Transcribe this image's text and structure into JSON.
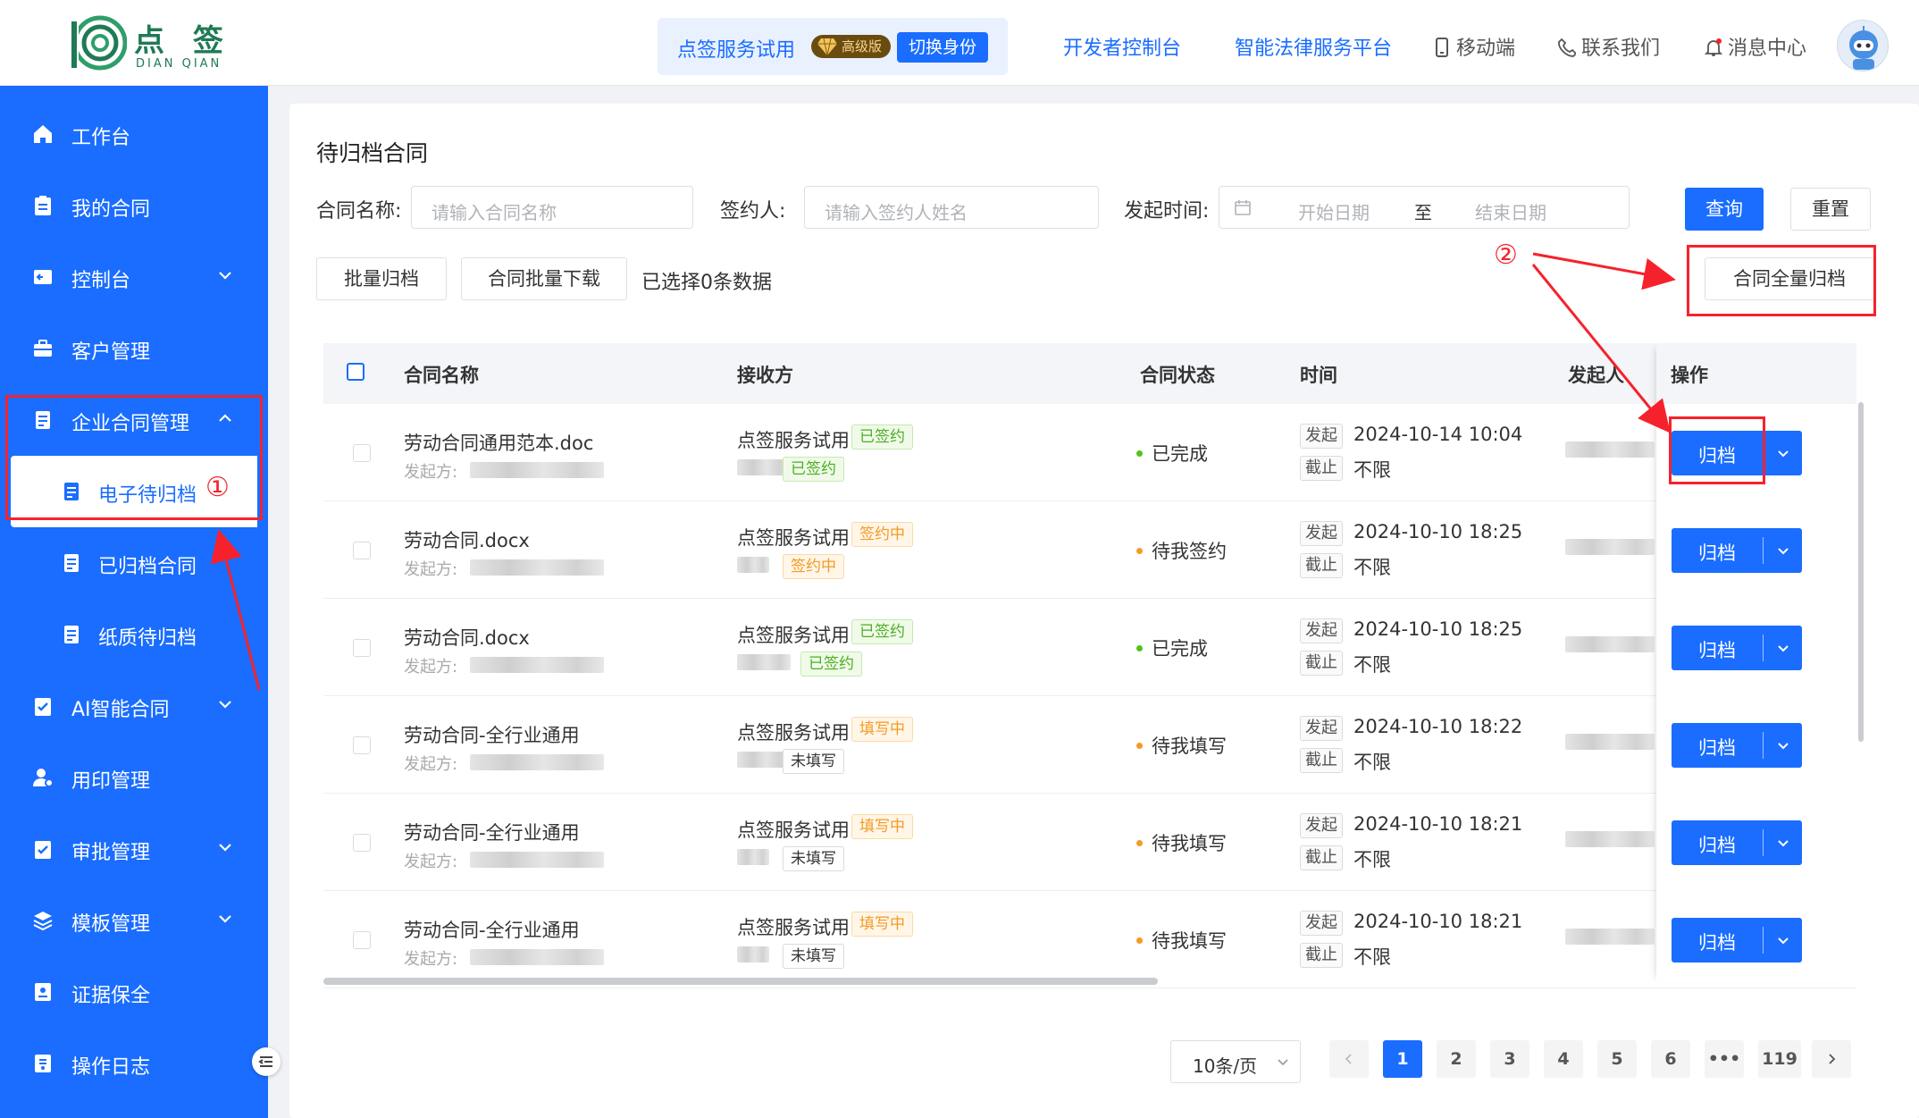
{
  "header": {
    "logo_cn": "点 签",
    "logo_en": "DIAN QIAN",
    "identity_name": "点签服务试用",
    "vip_label": "高级版",
    "switch_identity": "切换身份",
    "nav": [
      "开发者控制台",
      "智能法律服务平台",
      "移动端",
      "联系我们",
      "消息中心"
    ]
  },
  "sidebar": {
    "items": [
      {
        "label": "工作台"
      },
      {
        "label": "我的合同"
      },
      {
        "label": "控制台"
      },
      {
        "label": "客户管理"
      },
      {
        "label": "企业合同管理"
      },
      {
        "label": "电子待归档"
      },
      {
        "label": "已归档合同"
      },
      {
        "label": "纸质待归档"
      },
      {
        "label": "AI智能合同"
      },
      {
        "label": "用印管理"
      },
      {
        "label": "审批管理"
      },
      {
        "label": "模板管理"
      },
      {
        "label": "证据保全"
      },
      {
        "label": "操作日志"
      }
    ]
  },
  "page": {
    "title": "待归档合同",
    "filters": {
      "name_label": "合同名称:",
      "name_placeholder": "请输入合同名称",
      "signer_label": "签约人:",
      "signer_placeholder": "请输入签约人姓名",
      "time_label": "发起时间:",
      "start_placeholder": "开始日期",
      "range_sep": "至",
      "end_placeholder": "结束日期",
      "query": "查询",
      "reset": "重置"
    },
    "actions": {
      "batch_archive": "批量归档",
      "batch_download": "合同批量下载",
      "selected_info": "已选择0条数据",
      "archive_all": "合同全量归档"
    }
  },
  "table": {
    "columns": [
      "合同名称",
      "接收方",
      "合同状态",
      "时间",
      "发起人",
      "操作"
    ],
    "initiator_label": "发起方:",
    "start_tag": "发起",
    "end_tag": "截止",
    "archive_label": "归档",
    "rows": [
      {
        "name": "劳动合同通用范本.doc",
        "receiver": "点签服务试用",
        "receiver_tag": "已签约",
        "party_tag": "已签约",
        "status": "已完成",
        "start": "2024-10-14 10:04",
        "end": "不限"
      },
      {
        "name": "劳动合同.docx",
        "receiver": "点签服务试用",
        "receiver_tag": "签约中",
        "party_tag": "签约中",
        "status": "待我签约",
        "start": "2024-10-10 18:25",
        "end": "不限"
      },
      {
        "name": "劳动合同.docx",
        "receiver": "点签服务试用",
        "receiver_tag": "已签约",
        "party_tag": "已签约",
        "status": "已完成",
        "start": "2024-10-10 18:25",
        "end": "不限"
      },
      {
        "name": "劳动合同-全行业通用",
        "receiver": "点签服务试用",
        "receiver_tag": "填写中",
        "party_tag": "未填写",
        "status": "待我填写",
        "start": "2024-10-10 18:22",
        "end": "不限"
      },
      {
        "name": "劳动合同-全行业通用",
        "receiver": "点签服务试用",
        "receiver_tag": "填写中",
        "party_tag": "未填写",
        "status": "待我填写",
        "start": "2024-10-10 18:21",
        "end": "不限"
      },
      {
        "name": "劳动合同-全行业通用",
        "receiver": "点签服务试用",
        "receiver_tag": "填写中",
        "party_tag": "未填写",
        "status": "待我填写",
        "start": "2024-10-10 18:21",
        "end": "不限"
      }
    ]
  },
  "pagination": {
    "page_size": "10条/页",
    "pages": [
      "1",
      "2",
      "3",
      "4",
      "5",
      "6",
      "•••",
      "119"
    ],
    "current": "1"
  },
  "annotations": {
    "marker1": "①",
    "marker2": "②"
  },
  "colors": {
    "primary": "#1a6dff",
    "annotation": "#f5222d",
    "tag_green": "#4caf24",
    "tag_orange": "#f59a23"
  }
}
